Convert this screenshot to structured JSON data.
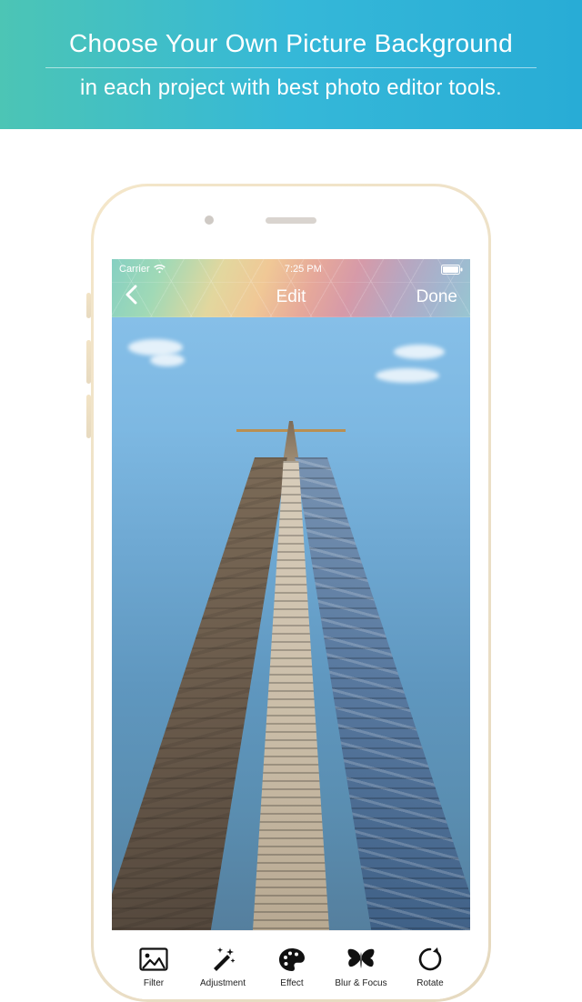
{
  "promo": {
    "title": "Choose Your Own Picture Background",
    "subtitle": "in each project with best photo editor tools."
  },
  "statusbar": {
    "carrier": "Carrier",
    "time": "7:25 PM"
  },
  "nav": {
    "title": "Edit",
    "done": "Done"
  },
  "toolbar": {
    "items": [
      {
        "label": "Filter"
      },
      {
        "label": "Adjustment"
      },
      {
        "label": "Effect"
      },
      {
        "label": "Blur & Focus"
      },
      {
        "label": "Rotate"
      }
    ]
  }
}
